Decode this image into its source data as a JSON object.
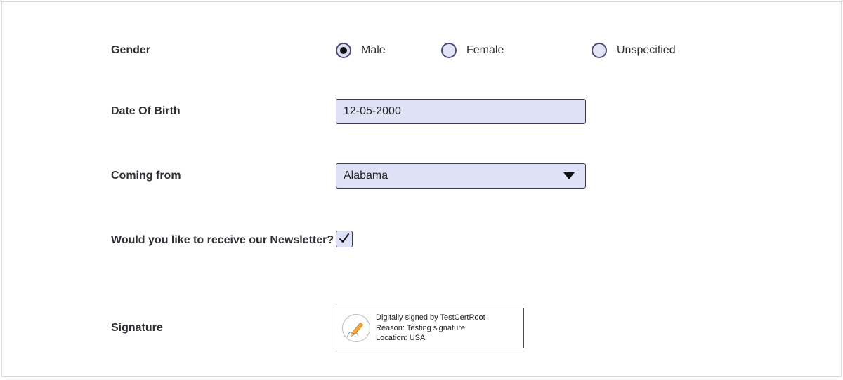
{
  "labels": {
    "gender": "Gender",
    "dob": "Date Of Birth",
    "coming_from": "Coming from",
    "newsletter": "Would you like to receive our Newsletter?",
    "signature": "Signature"
  },
  "gender": {
    "options": {
      "male": "Male",
      "female": "Female",
      "unspecified": "Unspecified"
    },
    "selected": "male"
  },
  "dob": {
    "value": "12-05-2000"
  },
  "coming_from": {
    "value": "Alabama"
  },
  "newsletter": {
    "checked": true
  },
  "signature": {
    "line1": "Digitally signed by TestCertRoot",
    "line2": "Reason: Testing signature",
    "line3": "Location: USA"
  }
}
